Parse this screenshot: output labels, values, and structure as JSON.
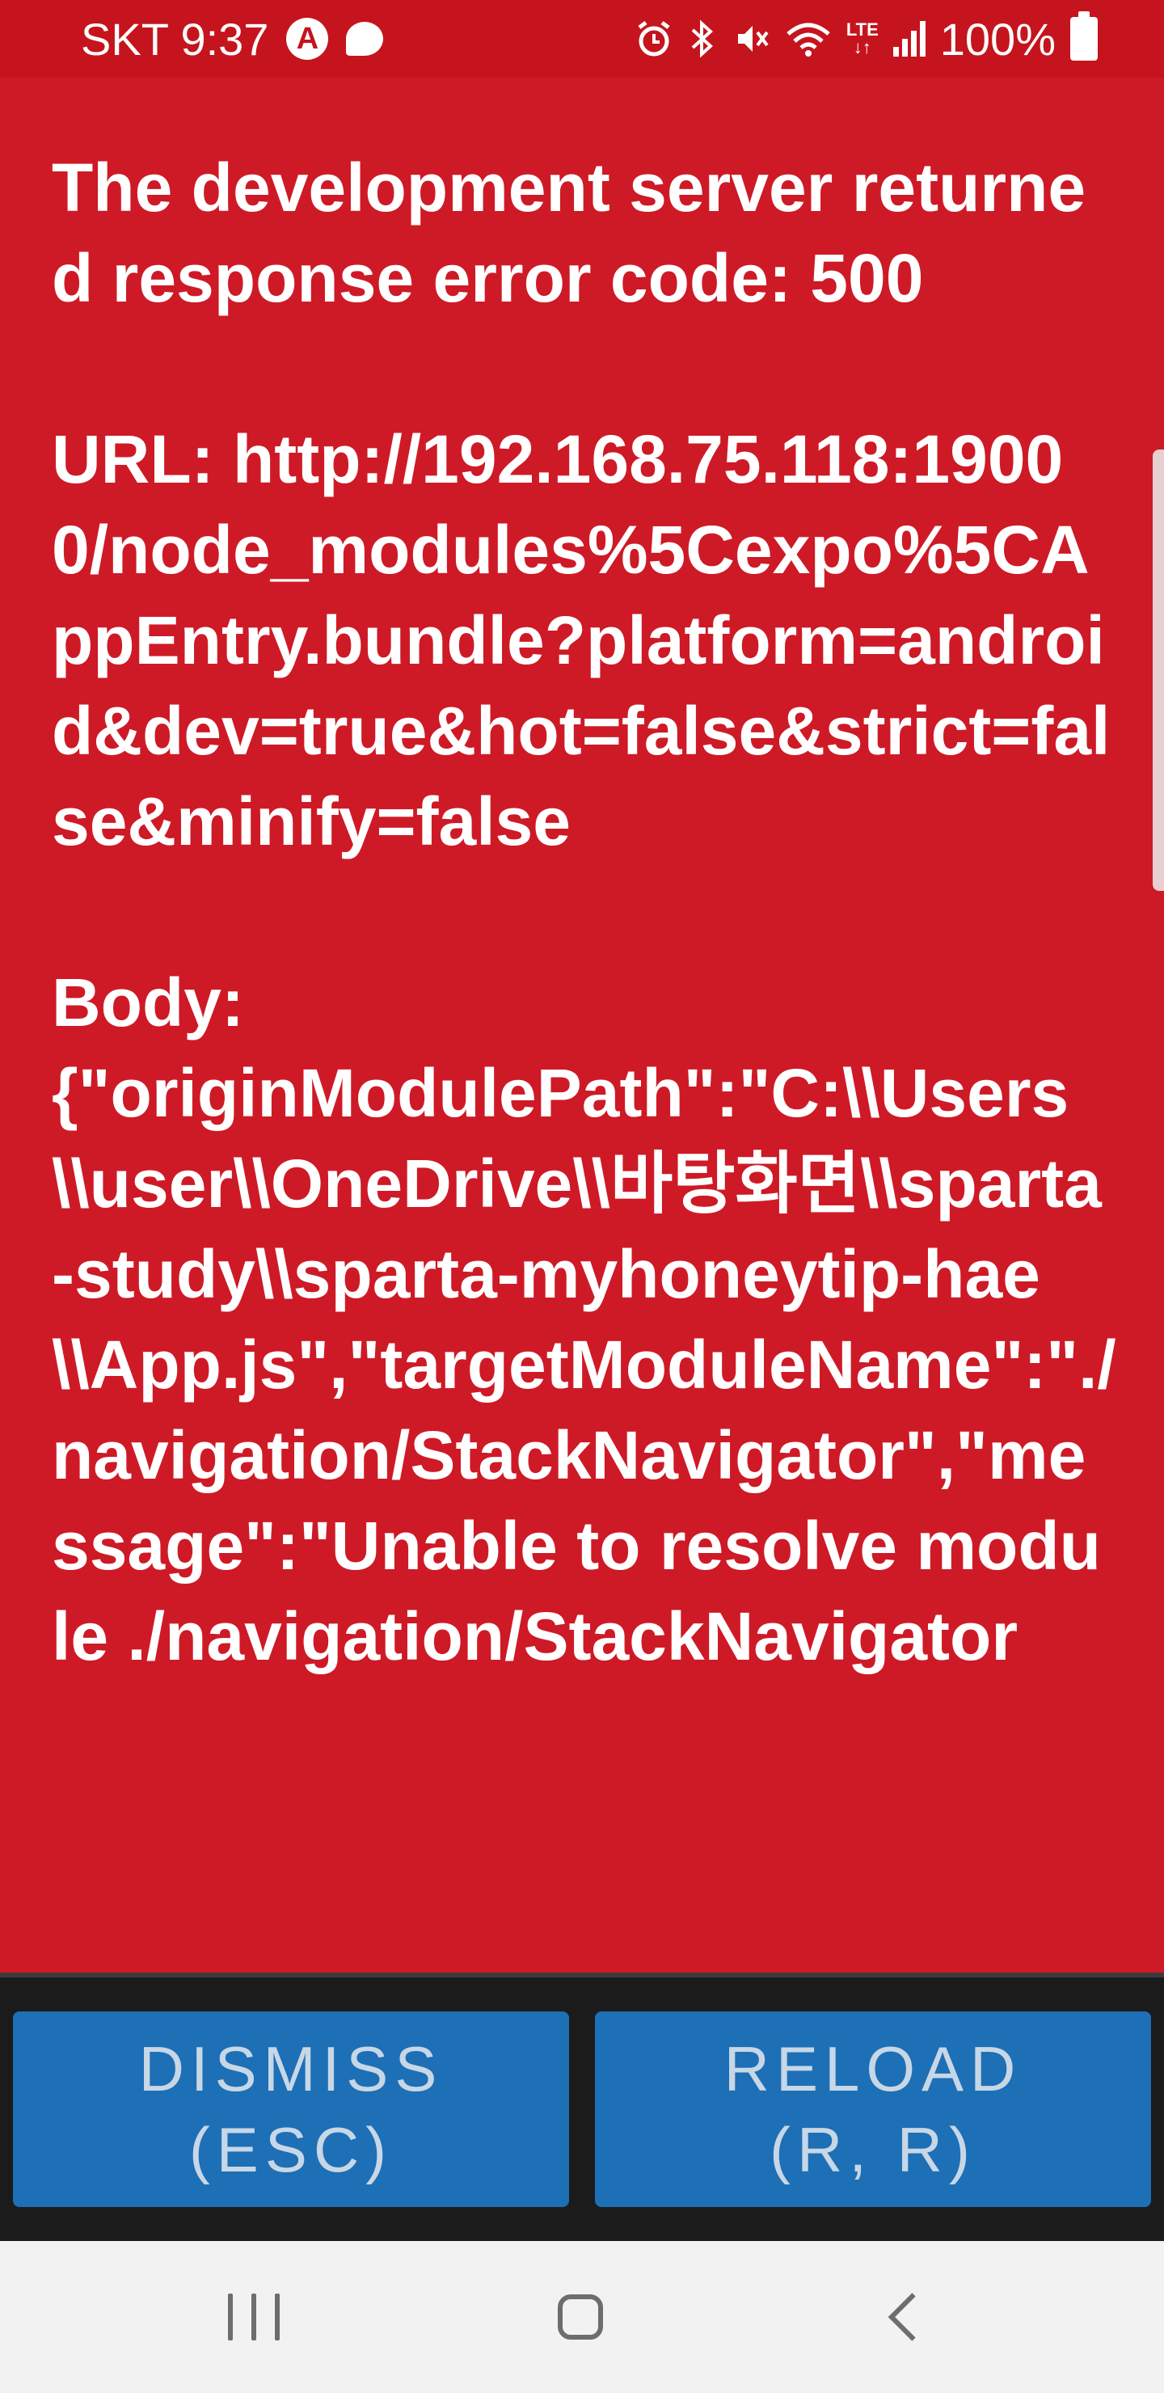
{
  "status_bar": {
    "carrier_time": "SKT 9:37",
    "battery_text": "100%",
    "network_label": "LTE",
    "icons": [
      "autofill-a-icon",
      "chat-bubble-icon",
      "alarm-icon",
      "bluetooth-icon",
      "mute-icon",
      "wifi-icon",
      "lte-icon",
      "signal-icon",
      "battery-icon"
    ]
  },
  "error": {
    "message": "The development server returned response error code: 500\n\nURL: http://192.168.75.118:19000/node_modules%5Cexpo%5CAppEntry.bundle?platform=android&dev=true&hot=false&strict=false&minify=false\n\nBody:\n{\"originModulePath\":\"C:\\\\Users\\\\user\\\\OneDrive\\\\바탕화면\\\\sparta-study\\\\sparta-myhoneytip-hae\\\\App.js\",\"targetModuleName\":\"./navigation/StackNavigator\",\"message\":\"Unable to resolve module ./navigation/StackNavigator"
  },
  "buttons": {
    "dismiss_line1": "DISMISS",
    "dismiss_line2": "(ESC)",
    "reload_line1": "RELOAD",
    "reload_line2": "(R, R)"
  },
  "nav": {
    "icons": [
      "recent-apps-icon",
      "home-icon",
      "back-icon"
    ]
  }
}
